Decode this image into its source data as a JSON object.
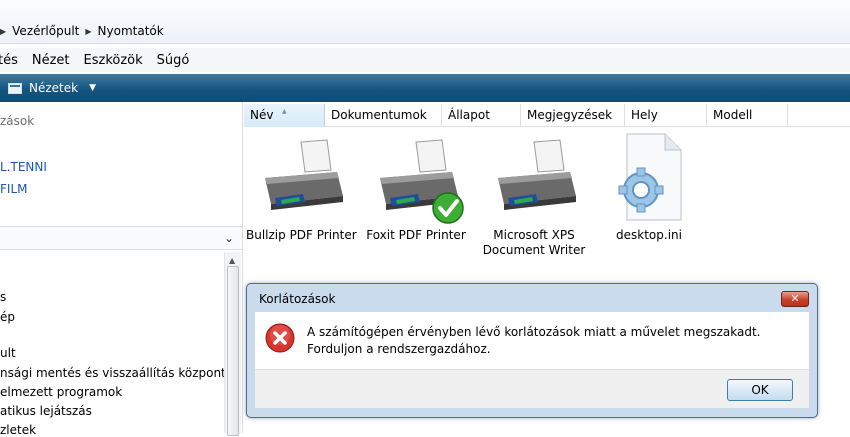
{
  "breadcrumb": {
    "items": [
      "Vezérlőpult",
      "Nyomtatók"
    ]
  },
  "menu": {
    "items": [
      "tés",
      "Nézet",
      "Eszközök",
      "Súgó"
    ]
  },
  "toolbar": {
    "views_label": "Nézetek"
  },
  "left_pane": {
    "top_items": [
      "zások",
      "L.TENNI",
      "FILM"
    ],
    "list_items": [
      "s",
      "ép",
      "ult",
      "nsági mentés és visszaállítás központja",
      "elmezett programok",
      "atikus lejátszás",
      "zletek"
    ]
  },
  "columns": [
    "Név",
    "Dokumentumok",
    "Állapot",
    "Megjegyzések",
    "Hely",
    "Modell"
  ],
  "items": [
    {
      "label": "Bullzip PDF Printer",
      "icon": "printer-icon"
    },
    {
      "label": "Foxit PDF Printer",
      "icon": "printer-icon",
      "default": true
    },
    {
      "label_line1": "Microsoft XPS",
      "label_line2": "Document Writer",
      "icon": "printer-icon"
    },
    {
      "label": "desktop.ini",
      "icon": "settings-file-icon"
    }
  ],
  "dialog": {
    "title": "Korlátozások",
    "message": "A számítógépen érvényben lévő korlátozások miatt a művelet megszakadt. Forduljon a rendszergazdához.",
    "ok_label": "OK",
    "close_glyph": "✕"
  },
  "colors": {
    "accent": "#16557f",
    "link": "#1a55b5",
    "error": "#c62828"
  }
}
